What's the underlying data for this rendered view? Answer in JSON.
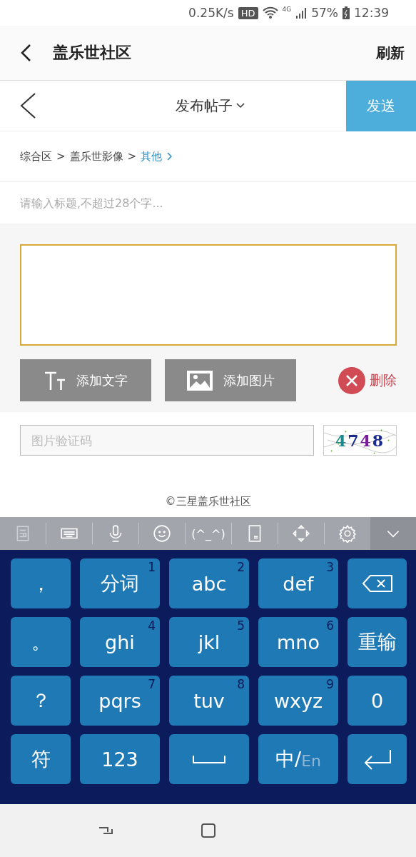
{
  "status_bar": {
    "speed": "0.25K/s",
    "hd": "HD",
    "network": "4G",
    "battery": "57%",
    "time": "12:39"
  },
  "app_header": {
    "title": "盖乐世社区",
    "action": "刷新"
  },
  "post_bar": {
    "title": "发布帖子",
    "send": "发送"
  },
  "breadcrumb_separator": ">",
  "breadcrumb": [
    {
      "label": "综合区",
      "link": false
    },
    {
      "label": "盖乐世影像",
      "link": false
    },
    {
      "label": "其他",
      "link": true
    }
  ],
  "title_field": {
    "placeholder": "请输入标题,不超过28个字..."
  },
  "content_field": {
    "focused": true
  },
  "buttons": [
    {
      "kind": "text",
      "label": "添加文字"
    },
    {
      "kind": "image",
      "label": "添加图片"
    }
  ],
  "delete": {
    "label": "删除"
  },
  "captcha": {
    "placeholder": "图片验证码",
    "code": "4748"
  },
  "footer": "©三星盖乐世社区",
  "keyboard_toolbar": [
    {
      "kind": "clipboard"
    },
    {
      "kind": "keyboard"
    },
    {
      "kind": "mic"
    },
    {
      "kind": "emoji"
    },
    {
      "kind": "text",
      "label": "(^_^)"
    },
    {
      "kind": "keypad"
    },
    {
      "kind": "arrows"
    },
    {
      "kind": "gear"
    },
    {
      "kind": "collapse"
    }
  ],
  "keys": [
    {
      "kind": "char",
      "label": "，"
    },
    {
      "kind": "char",
      "label": "分词",
      "num": "1"
    },
    {
      "kind": "char",
      "label": "abc",
      "num": "2"
    },
    {
      "kind": "char",
      "label": "def",
      "num": "3"
    },
    {
      "kind": "backspace"
    },
    {
      "kind": "char",
      "label": "。"
    },
    {
      "kind": "char",
      "label": "ghi",
      "num": "4"
    },
    {
      "kind": "char",
      "label": "jkl",
      "num": "5"
    },
    {
      "kind": "char",
      "label": "mno",
      "num": "6"
    },
    {
      "kind": "char",
      "label": "重输"
    },
    {
      "kind": "char",
      "label": "？"
    },
    {
      "kind": "char",
      "label": "pqrs",
      "num": "7"
    },
    {
      "kind": "char",
      "label": "tuv",
      "num": "8"
    },
    {
      "kind": "char",
      "label": "wxyz",
      "num": "9"
    },
    {
      "kind": "char",
      "label": "0"
    },
    {
      "kind": "char",
      "label": "符"
    },
    {
      "kind": "char",
      "label": "123"
    },
    {
      "kind": "space"
    },
    {
      "kind": "lang",
      "label": "中/",
      "sub": "En"
    },
    {
      "kind": "enter"
    }
  ]
}
